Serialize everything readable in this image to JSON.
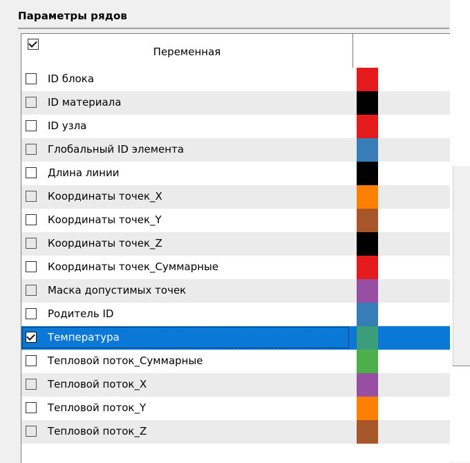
{
  "panel": {
    "title": "Параметры рядов"
  },
  "table": {
    "header": {
      "variable_label": "Переменная",
      "select_all_checked": true
    },
    "rows": [
      {
        "label": "ID блока",
        "checked": false,
        "color": "#e41a1c"
      },
      {
        "label": "ID материала",
        "checked": false,
        "color": "#000000"
      },
      {
        "label": "ID узла",
        "checked": false,
        "color": "#e41a1c"
      },
      {
        "label": "Глобальный ID элемента",
        "checked": false,
        "color": "#377eb8"
      },
      {
        "label": "Длина линии",
        "checked": false,
        "color": "#000000"
      },
      {
        "label": "Координаты точек_X",
        "checked": false,
        "color": "#ff7f00"
      },
      {
        "label": "Координаты точек_Y",
        "checked": false,
        "color": "#a65628"
      },
      {
        "label": "Координаты точек_Z",
        "checked": false,
        "color": "#000000"
      },
      {
        "label": "Координаты точек_Суммарные",
        "checked": false,
        "color": "#e41a1c"
      },
      {
        "label": "Маска допустимых точек",
        "checked": false,
        "color": "#984ea3"
      },
      {
        "label": "Родитель ID",
        "checked": false,
        "color": "#377eb8"
      },
      {
        "label": "Температура",
        "checked": true,
        "selected": true,
        "color": "#3a9e7a"
      },
      {
        "label": "Тепловой поток_Суммарные",
        "checked": false,
        "color": "#4daf4a"
      },
      {
        "label": "Тепловой поток_X",
        "checked": false,
        "color": "#984ea3"
      },
      {
        "label": "Тепловой поток_Y",
        "checked": false,
        "color": "#ff7f00"
      },
      {
        "label": "Тепловой поток_Z",
        "checked": false,
        "color": "#a65628"
      }
    ]
  }
}
